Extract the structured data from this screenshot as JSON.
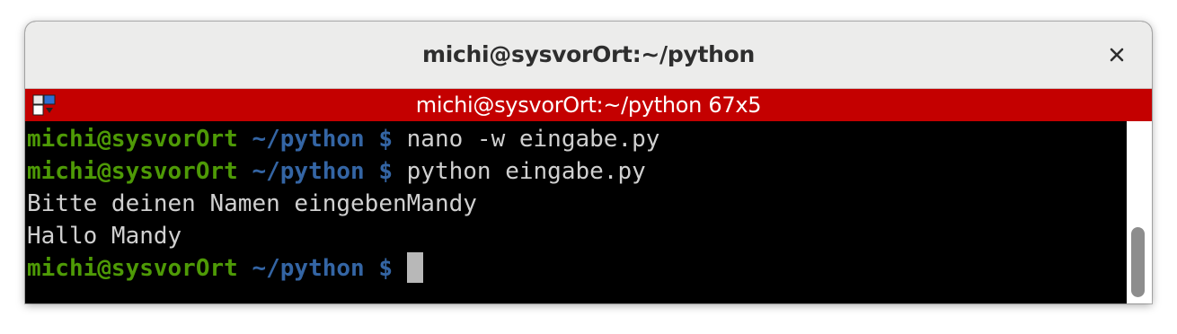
{
  "window": {
    "title": "michi@sysvorOrt:~/python",
    "close_label": "×"
  },
  "tabbar": {
    "title": "michi@sysvorOrt:~/python 67x5",
    "icon": "screen-split-icon"
  },
  "terminal": {
    "lines": [
      {
        "user": "michi@sysvorOrt",
        "path": " ~/python $",
        "command": " nano -w eingabe.py"
      },
      {
        "user": "michi@sysvorOrt",
        "path": " ~/python $",
        "command": " python eingabe.py"
      },
      {
        "output": "Bitte deinen Namen eingebenMandy"
      },
      {
        "output": "Hallo Mandy"
      },
      {
        "user": "michi@sysvorOrt",
        "path": " ~/python $",
        "command": " "
      }
    ]
  },
  "colors": {
    "tab_background": "#c40000",
    "user_prompt": "#4e9a06",
    "path_prompt": "#3465a4",
    "terminal_bg": "#000000",
    "terminal_text": "#d0d0d0"
  },
  "scrollbar": {
    "position": "bottom"
  }
}
